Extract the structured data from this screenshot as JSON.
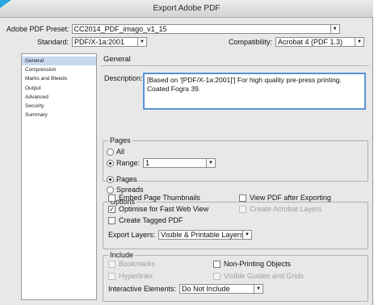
{
  "window": {
    "title": "Export Adobe PDF"
  },
  "preset": {
    "label": "Adobe PDF Preset:",
    "value": "CC2014_PDF_imago_v1_15"
  },
  "standard": {
    "label": "Standard:",
    "value": "PDF/X-1a:2001"
  },
  "compatibility": {
    "label": "Compatibility:",
    "value": "Acrobat 4 (PDF 1.3)"
  },
  "sidebar": {
    "items": [
      {
        "label": "General"
      },
      {
        "label": "Compression"
      },
      {
        "label": "Marks and Bleeds"
      },
      {
        "label": "Output"
      },
      {
        "label": "Advanced"
      },
      {
        "label": "Security"
      },
      {
        "label": "Summary"
      }
    ]
  },
  "general": {
    "heading": "General",
    "description_label": "Description:",
    "description_line1": "[Based on '[PDF/X-1a:2001]'] For high quality pre-press printing.",
    "description_line2": "Coated Fogra 39."
  },
  "pages": {
    "title": "Pages",
    "all": "All",
    "range_label": "Range:",
    "range_value": "1",
    "pages_option": "Pages",
    "spreads_option": "Spreads"
  },
  "options": {
    "title": "Options",
    "embed_thumbnails": "Embed Page Thumbnails",
    "view_after": "View PDF after Exporting",
    "optimise": "Optimise for Fast Web View",
    "acrobat_layers": "Create Acrobat Layers",
    "tagged_pdf": "Create Tagged PDF",
    "export_layers_label": "Export Layers:",
    "export_layers_value": "Visible & Printable Layers"
  },
  "include": {
    "title": "Include",
    "bookmarks": "Bookmarks",
    "non_printing": "Non-Printing Objects",
    "hyperlinks": "Hyperlinks",
    "guides_grids": "Visible Guides and Grids",
    "interactive_label": "Interactive Elements:",
    "interactive_value": "Do Not Include"
  },
  "glyphs": {
    "arrow": "▼",
    "check": "✓"
  },
  "colors": {
    "accent": "#5a93d6",
    "selection": "#c8d8ef",
    "corner": "#2aa7e0"
  }
}
